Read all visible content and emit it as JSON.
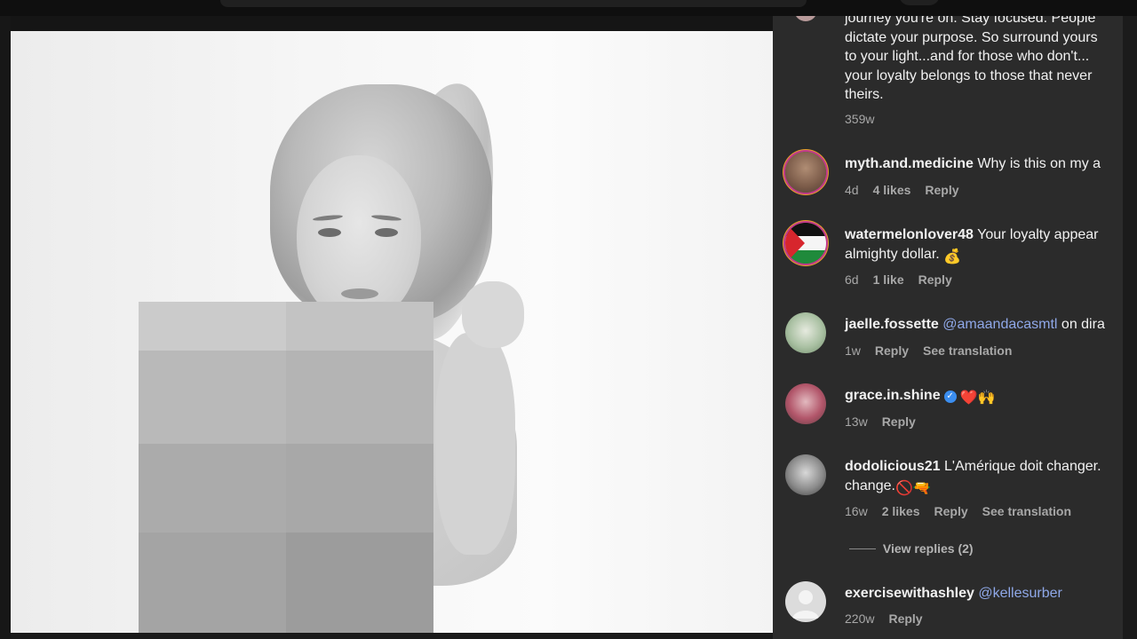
{
  "comments": [
    {
      "lines": [
        "journey you're on. Stay focused. People",
        "dictate your purpose. So surround yours",
        "to your light...and for those who don't...",
        "your loyalty belongs to those that never",
        "theirs."
      ],
      "meta": [
        "359w"
      ]
    },
    {
      "username": "myth.and.medicine",
      "text": " Why is this on my a",
      "meta": [
        "4d",
        "4 likes",
        "Reply"
      ]
    },
    {
      "username": "watermelonlover48",
      "text": " Your loyalty appear",
      "line2": "almighty dollar. ",
      "emoji": "💰",
      "meta": [
        "6d",
        "1 like",
        "Reply"
      ]
    },
    {
      "username": "jaelle.fossette",
      "mention": "@amaandacasmtl",
      "text": " on dira",
      "meta": [
        "1w",
        "Reply",
        "See translation"
      ]
    },
    {
      "username": "grace.in.shine",
      "verified_glyph": "✓",
      "emoji": "❤️🙌",
      "meta": [
        "13w",
        "Reply"
      ]
    },
    {
      "username": "dodolicious21",
      "text": " L'Amérique doit changer.",
      "line2": "change.",
      "emoji": "🚫🔫",
      "meta": [
        "16w",
        "2 likes",
        "Reply",
        "See translation"
      ]
    },
    {
      "view_replies": "View replies (2)"
    },
    {
      "username": "exercisewithashley",
      "mention": "@kellesurber",
      "meta": [
        "220w",
        "Reply"
      ]
    }
  ],
  "colors": {
    "panel_bg": "#2b2b2b",
    "mention": "#8fa8e8",
    "meta_text": "#a8a8a8",
    "verified_badge": "#3b8ef0"
  },
  "icons": [
    "verified-badge-icon",
    "default-avatar-icon"
  ]
}
